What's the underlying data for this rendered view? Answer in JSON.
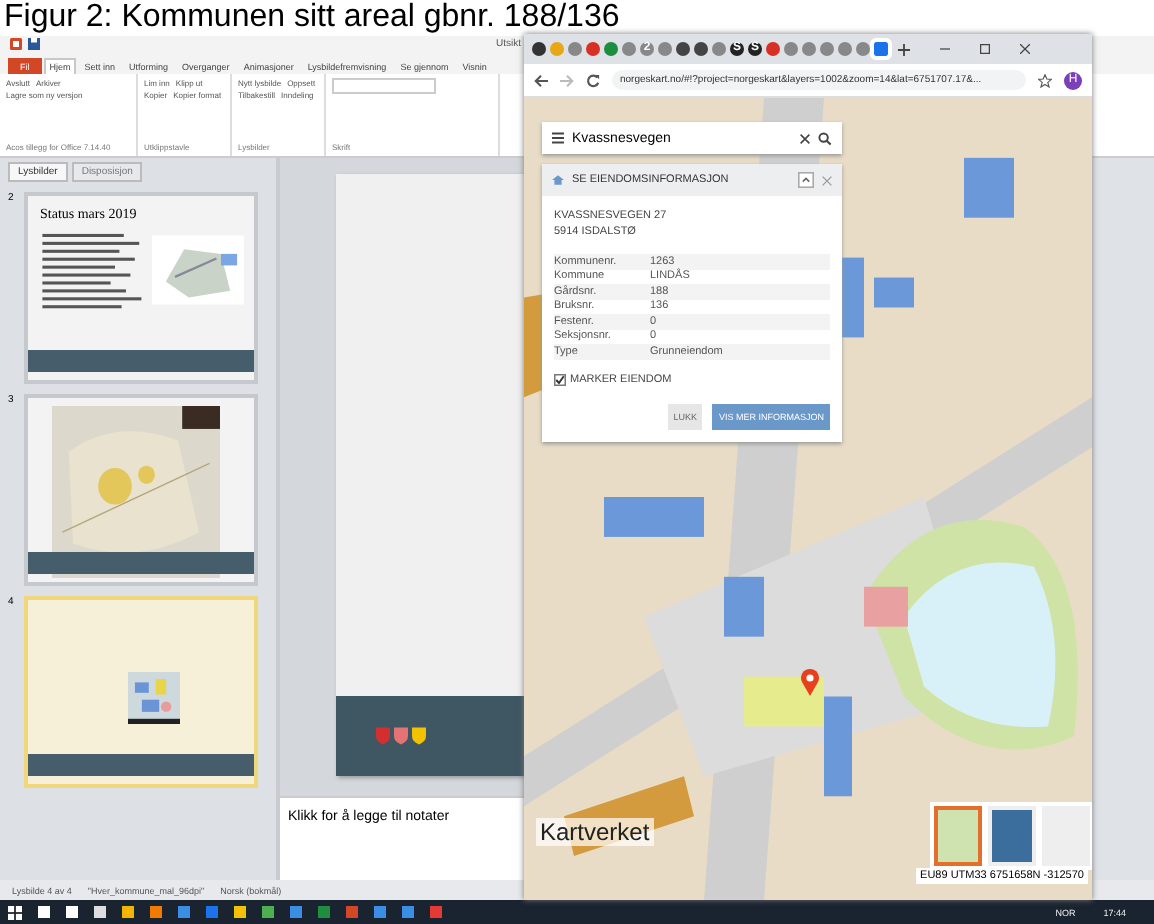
{
  "caption": "Figur 2: Kommunen sitt areal gbnr. 188/136",
  "ppt": {
    "title": "Utsikt",
    "ribbon_tabs": [
      {
        "label": "Fil",
        "selected": false,
        "kind": "file"
      },
      {
        "label": "Hjem",
        "selected": true,
        "kind": "tab"
      },
      {
        "label": "Sett inn",
        "selected": false,
        "kind": "tab"
      },
      {
        "label": "Utforming",
        "selected": false,
        "kind": "tab"
      },
      {
        "label": "Overganger",
        "selected": false,
        "kind": "tab"
      },
      {
        "label": "Animasjoner",
        "selected": false,
        "kind": "tab"
      },
      {
        "label": "Lysbildefremvisning",
        "selected": false,
        "kind": "tab"
      },
      {
        "label": "Se gjennom",
        "selected": false,
        "kind": "tab"
      },
      {
        "label": "Visnin",
        "selected": false,
        "kind": "tab"
      }
    ],
    "ribbon_groups": [
      {
        "label": "Acos tillegg for Office 7.14.40",
        "items": [
          "Avslutt",
          "Arkiver",
          "Lagre som ny versjon"
        ]
      },
      {
        "label": "Utklippstavle",
        "items": [
          "Lim inn",
          "Klipp ut",
          "Kopier",
          "Kopier format"
        ]
      },
      {
        "label": "Lysbilder",
        "items": [
          "Nytt lysbilde",
          "Oppsett",
          "Tilbakestill",
          "Inndeling"
        ]
      },
      {
        "label": "Skrift"
      }
    ],
    "pane_tabs": [
      {
        "label": "Lysbilder",
        "selected": true
      },
      {
        "label": "Disposisjon",
        "selected": false
      }
    ],
    "slides": [
      {
        "number": "2",
        "title": "Status mars 2019",
        "selected": false,
        "kind": "text"
      },
      {
        "number": "3",
        "selected": false
      },
      {
        "number": "4",
        "selected": true,
        "kind": "map"
      }
    ],
    "notes_placeholder": "Klikk for å legge til notater",
    "status_bar": [
      "Lysbilde 4 av 4",
      "\"Hver_kommune_mal_96dpi\"",
      "Norsk (bokmål)"
    ]
  },
  "browser": {
    "tabs": [
      {
        "color": "#333333",
        "selected": false
      },
      {
        "color": "#e6a817",
        "selected": false
      },
      {
        "color": "#888888",
        "selected": false
      },
      {
        "color": "#d93025",
        "selected": false
      },
      {
        "color": "#1e8e3e",
        "selected": false
      },
      {
        "color": "#888888",
        "selected": false
      },
      {
        "color": "#888888",
        "selected": false,
        "glyph": "2"
      },
      {
        "color": "#888888",
        "selected": false
      },
      {
        "color": "#444444",
        "selected": false
      },
      {
        "color": "#444444",
        "selected": false
      },
      {
        "color": "#888888",
        "selected": false
      },
      {
        "color": "#222222",
        "selected": false,
        "glyph": "S"
      },
      {
        "color": "#222222",
        "selected": false,
        "glyph": "S"
      },
      {
        "color": "#d93025",
        "selected": false
      },
      {
        "color": "#888888",
        "selected": false
      },
      {
        "color": "#888888",
        "selected": false
      },
      {
        "color": "#888888",
        "selected": false
      },
      {
        "color": "#888888",
        "selected": false
      },
      {
        "color": "#888888",
        "selected": false
      },
      {
        "color": "#1a73e8",
        "selected": true
      }
    ],
    "address": "norgeskart.no/#!?project=norgeskart&layers=1002&zoom=14&lat=6751707.17&...",
    "profile": "H",
    "panel": {
      "search": "Kvassnesvegen",
      "heading": "SE EIENDOMSINFORMASJON",
      "address_lines": [
        "KVASSNESVEGEN 27",
        "5914 ISDALSTØ"
      ],
      "rows": [
        {
          "label": "Kommunenr.",
          "value": "1263"
        },
        {
          "label": "Kommune",
          "value": "LINDÅS"
        },
        {
          "label": "Gårdsnr.",
          "value": "188"
        },
        {
          "label": "Bruksnr.",
          "value": "136"
        },
        {
          "label": "Festenr.",
          "value": "0"
        },
        {
          "label": "Seksjonsnr.",
          "value": "0"
        },
        {
          "label": "Type",
          "value": "Grunneiendom"
        }
      ],
      "marker": {
        "label": "MARKER EIENDOM",
        "checked": true
      },
      "buttons": [
        {
          "label": "LUKK",
          "kind": "plain"
        },
        {
          "label": "VIS MER INFORMASJON",
          "kind": "primary"
        }
      ]
    },
    "logo": "Kartverket",
    "basemaps": [
      {
        "color": "#cfe3b0",
        "selected": true
      },
      {
        "color": "#3b6e9c",
        "selected": false
      },
      {
        "color": "#eeeeee",
        "selected": false
      }
    ],
    "coordinates": "EU89 UTM33 6751658N -312570"
  },
  "taskbar": {
    "icons": [
      {
        "color": "#ffffff"
      },
      {
        "color": "#ffffff"
      },
      {
        "color": "#dddddd"
      },
      {
        "color": "#f2b600"
      },
      {
        "color": "#f27a00"
      },
      {
        "color": "#3a8ee6"
      },
      {
        "color": "#1a73e8"
      },
      {
        "color": "#f2c200"
      },
      {
        "color": "#4caf50"
      },
      {
        "color": "#3a8ee6"
      },
      {
        "color": "#1e8e3e"
      },
      {
        "color": "#d24726"
      },
      {
        "color": "#3a8ee6"
      },
      {
        "color": "#3a8ee6"
      },
      {
        "color": "#e53935"
      }
    ],
    "tray": [
      "NOR",
      "17:44"
    ]
  }
}
